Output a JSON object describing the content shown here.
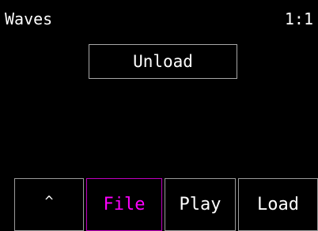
{
  "header": {
    "title": "Waves",
    "indicator": "1:1"
  },
  "main": {
    "unload_label": "Unload"
  },
  "softkeys": {
    "up_label": "^",
    "file_label": "File",
    "play_label": "Play",
    "load_label": "Load"
  },
  "colors": {
    "background": "#000000",
    "text": "#ffffff",
    "active_accent": "#ff00ff",
    "border": "#a8a8a8"
  }
}
